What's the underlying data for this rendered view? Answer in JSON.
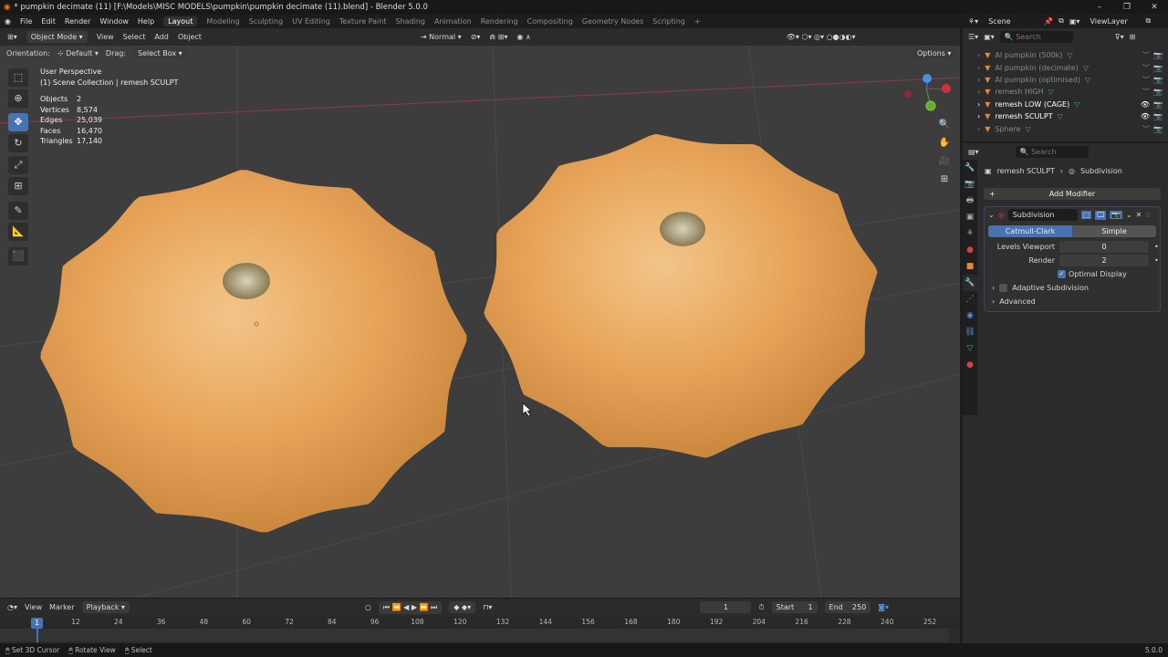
{
  "title": "* pumpkin decimate (11) [F:\\Models\\MISC MODELS\\pumpkin\\pumpkin decimate (11).blend] - Blender 5.0.0",
  "menu": [
    "File",
    "Edit",
    "Render",
    "Window",
    "Help"
  ],
  "workspaces": [
    "Layout",
    "Modeling",
    "Sculpting",
    "UV Editing",
    "Texture Paint",
    "Shading",
    "Animation",
    "Rendering",
    "Compositing",
    "Geometry Nodes",
    "Scripting",
    "+"
  ],
  "viewport": {
    "mode": "Object Mode",
    "menus": [
      "View",
      "Select",
      "Add",
      "Object"
    ],
    "transform": "Normal",
    "orientation_label": "Orientation:",
    "orientation": "Default",
    "drag_label": "Drag:",
    "drag": "Select Box",
    "options": "Options",
    "perspective": "User Perspective",
    "collection": "(1) Scene Collection | remesh SCULPT",
    "stats": [
      {
        "k": "Objects",
        "v": "2"
      },
      {
        "k": "Vertices",
        "v": "8,574"
      },
      {
        "k": "Edges",
        "v": "25,039"
      },
      {
        "k": "Faces",
        "v": "16,470"
      },
      {
        "k": "Triangles",
        "v": "17,140"
      }
    ]
  },
  "timeline": {
    "menus": [
      "View",
      "Marker",
      "Playback"
    ],
    "current": "1",
    "start_label": "Start",
    "start": "1",
    "end_label": "End",
    "end": "250",
    "ticks": [
      "12",
      "24",
      "36",
      "48",
      "60",
      "72",
      "84",
      "96",
      "108",
      "120",
      "132",
      "144",
      "156",
      "168",
      "180",
      "192",
      "204",
      "216",
      "228",
      "240",
      "252"
    ],
    "playhead": "1"
  },
  "status": {
    "items": [
      "Set 3D Cursor",
      "Rotate View",
      "Select"
    ],
    "version": "5.0.0"
  },
  "outliner": {
    "scene": "Scene",
    "viewlayer": "ViewLayer",
    "search_placeholder": "Search",
    "items": [
      {
        "name": "AI pumpkin (500k)",
        "visible": false
      },
      {
        "name": "AI pumpkin (decimate)",
        "visible": false
      },
      {
        "name": "AI pumpkin (optimised)",
        "visible": false
      },
      {
        "name": "remesh HIGH",
        "visible": false
      },
      {
        "name": "remesh LOW (CAGE)",
        "visible": true
      },
      {
        "name": "remesh SCULPT",
        "visible": true
      },
      {
        "name": "Sphere",
        "visible": false
      }
    ]
  },
  "properties": {
    "search_placeholder": "Search",
    "object": "remesh SCULPT",
    "modifier_crumb": "Subdivision",
    "add_modifier": "Add Modifier",
    "modifier": {
      "name": "Subdivision",
      "mode_a": "Catmull-Clark",
      "mode_b": "Simple",
      "levels_label": "Levels Viewport",
      "levels": "0",
      "render_label": "Render",
      "render": "2",
      "optimal": "Optimal Display",
      "adaptive": "Adaptive Subdivision",
      "advanced": "Advanced"
    }
  }
}
